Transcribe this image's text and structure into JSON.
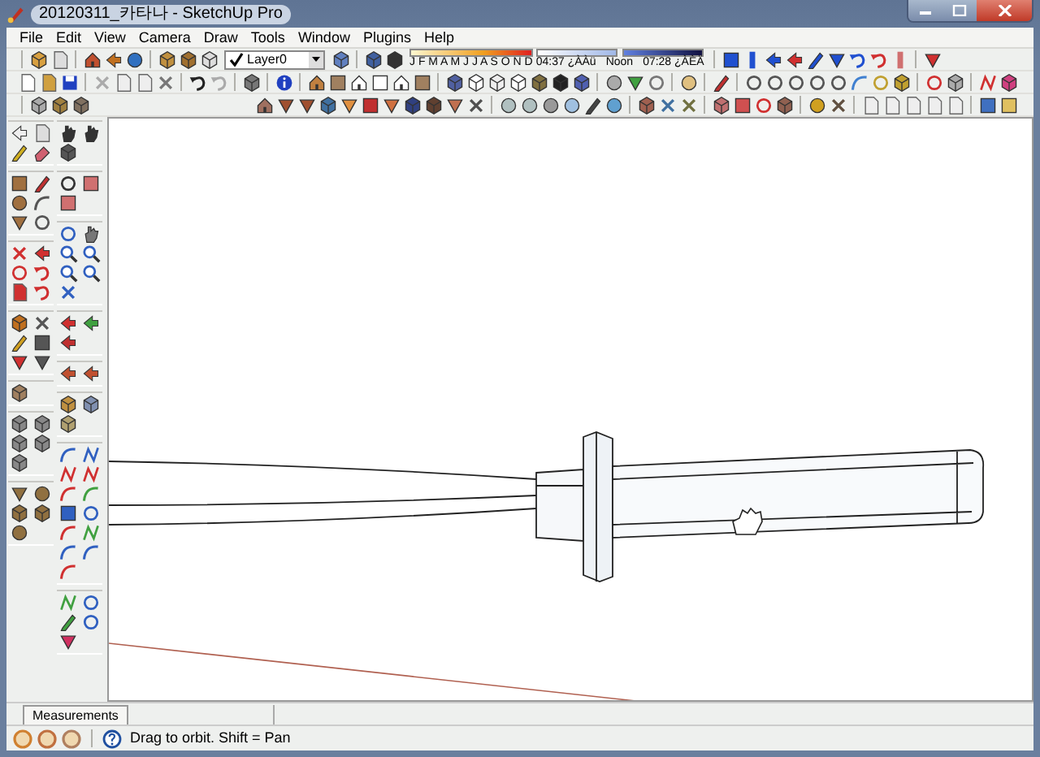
{
  "window": {
    "title": "20120311_카타나 - SketchUp Pro"
  },
  "menu": [
    "File",
    "Edit",
    "View",
    "Camera",
    "Draw",
    "Tools",
    "Window",
    "Plugins",
    "Help"
  ],
  "layer_dropdown": {
    "value": "Layer0"
  },
  "shadow": {
    "months": "J F M A M J J A S O N D",
    "time_start": "04:37 ¿ÀÀü",
    "time_noon": "Noon",
    "time_end": "07:28 ¿ÀÈÄ"
  },
  "measurements": {
    "label": "Measurements"
  },
  "status_bar": {
    "text": "Drag to orbit.  Shift = Pan"
  }
}
